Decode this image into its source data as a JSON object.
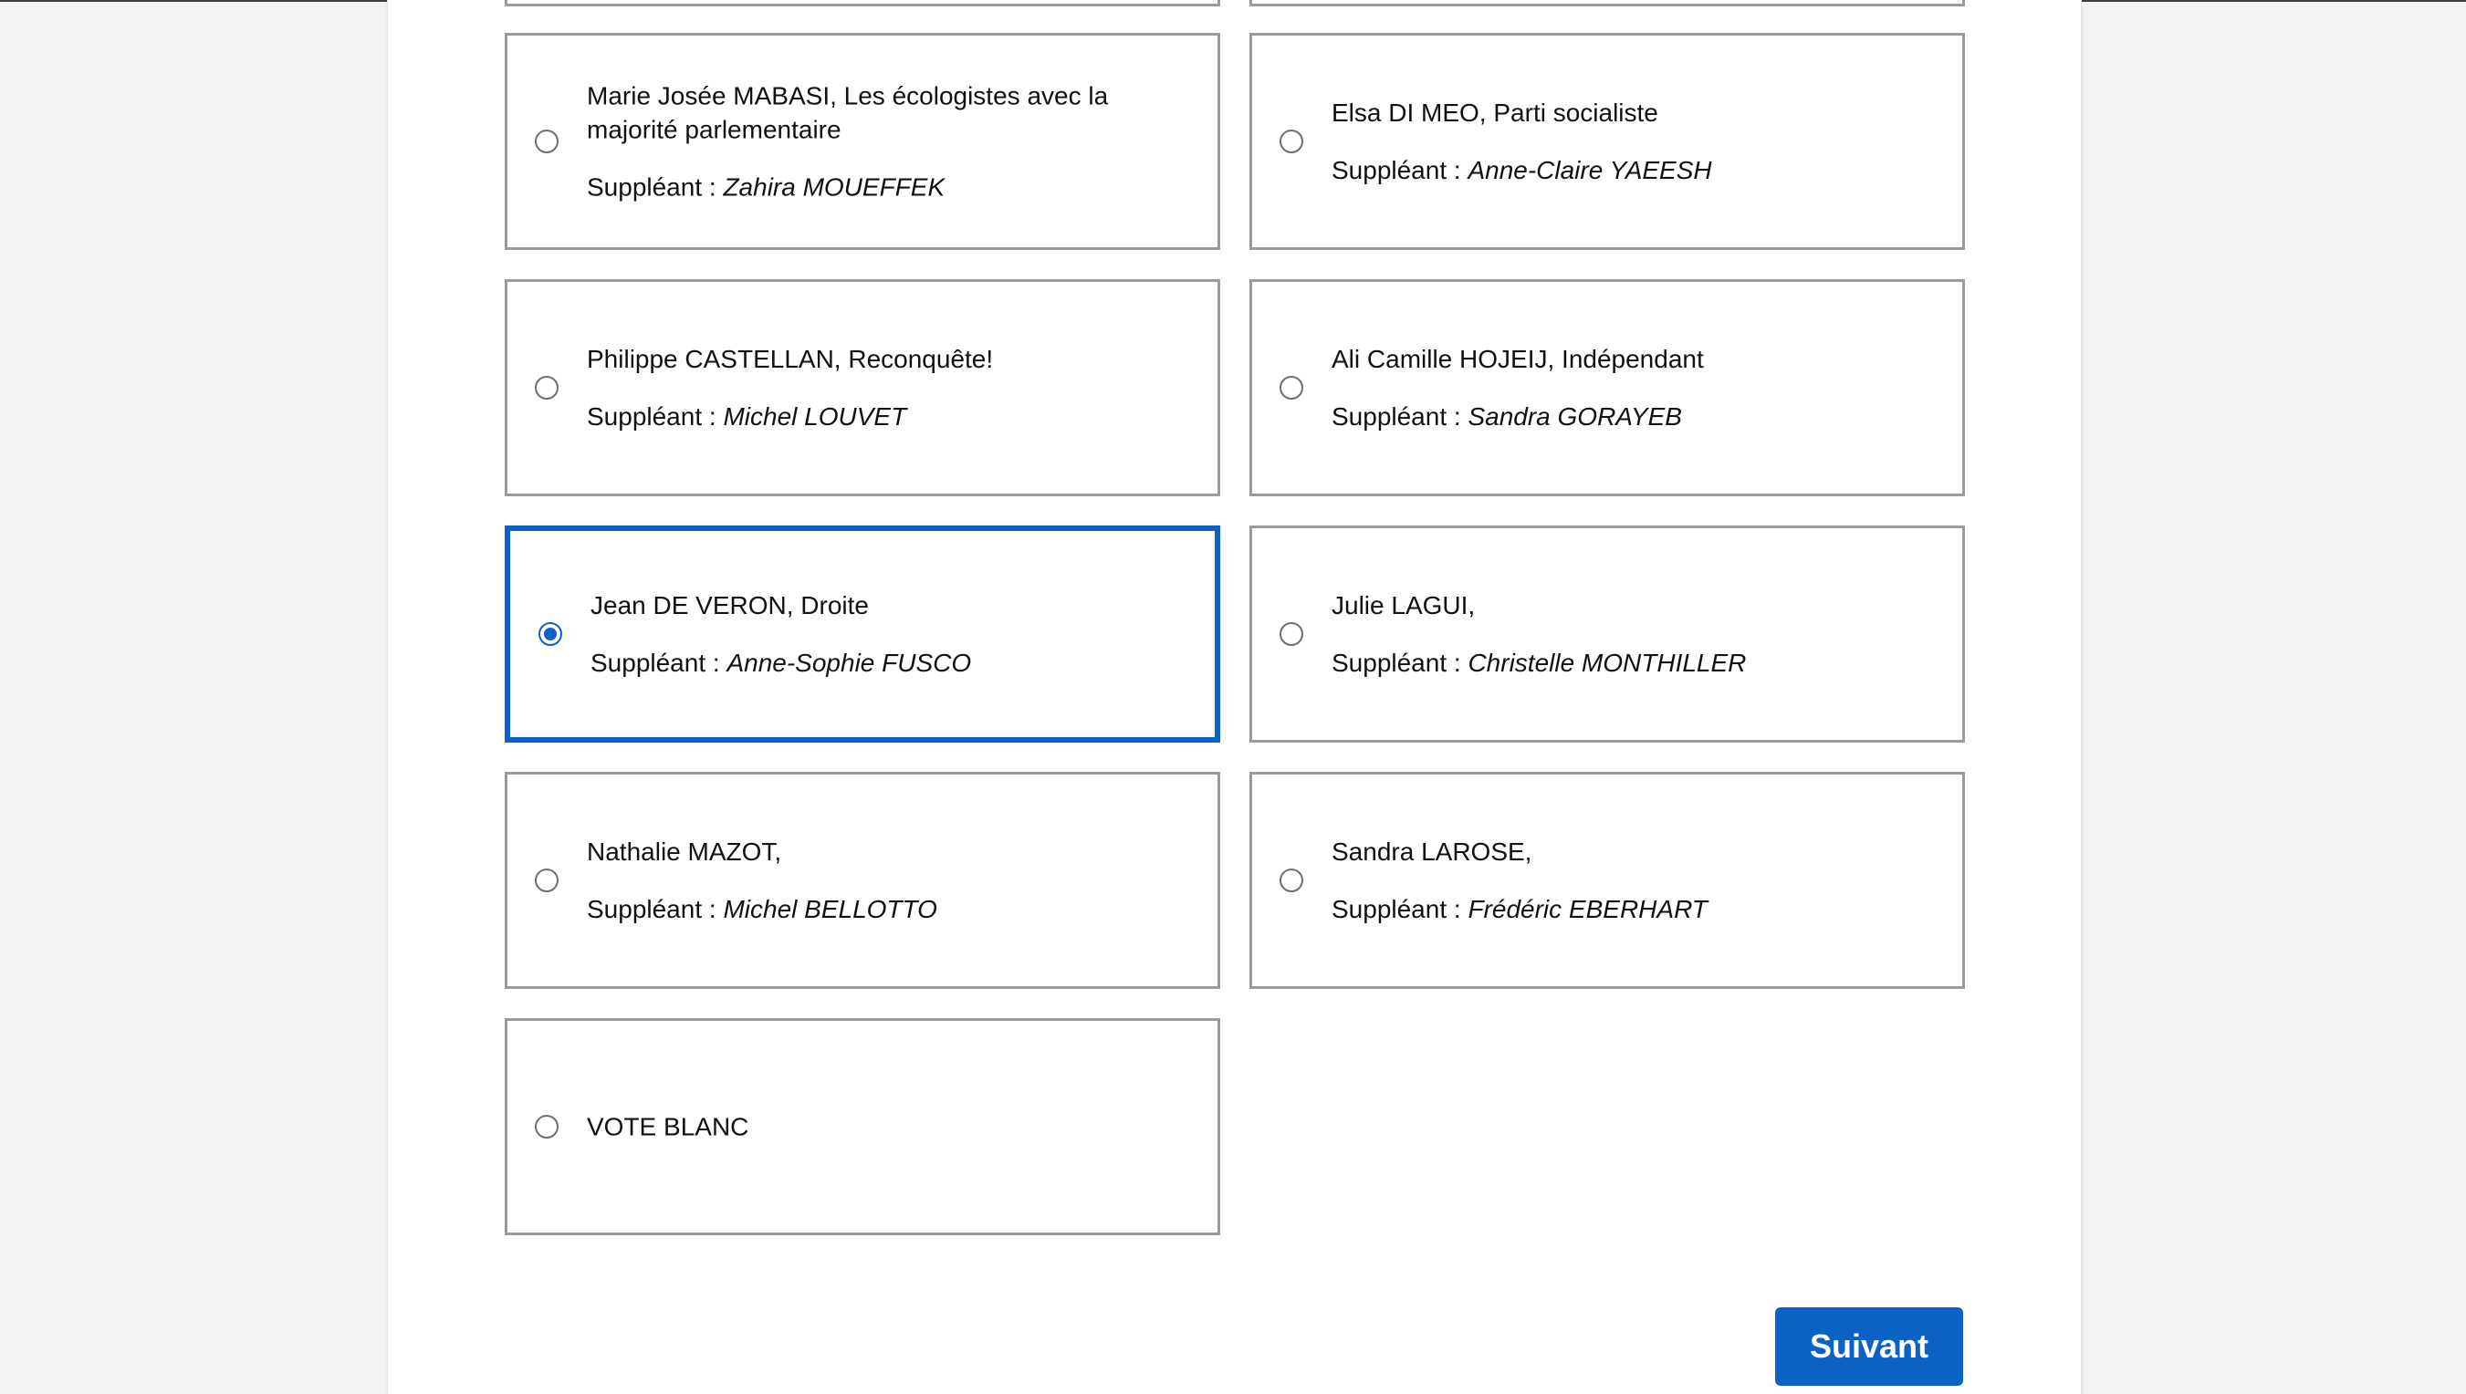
{
  "ballot": {
    "options": [
      {
        "candidate": "Marie Josée MABASI, Les écologistes avec la majorité parlementaire",
        "substitute_label": "Suppléant : ",
        "substitute": "Zahira MOUEFFEK",
        "selected": false
      },
      {
        "candidate": "Elsa DI MEO, Parti socialiste",
        "substitute_label": "Suppléant : ",
        "substitute": "Anne-Claire YAEESH",
        "selected": false
      },
      {
        "candidate": "Philippe CASTELLAN, Reconquête!",
        "substitute_label": "Suppléant : ",
        "substitute": "Michel LOUVET",
        "selected": false
      },
      {
        "candidate": "Ali Camille HOJEIJ, Indépendant",
        "substitute_label": "Suppléant : ",
        "substitute": "Sandra GORAYEB",
        "selected": false
      },
      {
        "candidate": "Jean DE VERON, Droite",
        "substitute_label": "Suppléant : ",
        "substitute": "Anne-Sophie FUSCO",
        "selected": true
      },
      {
        "candidate": "Julie LAGUI,",
        "substitute_label": "Suppléant : ",
        "substitute": "Christelle MONTHILLER",
        "selected": false
      },
      {
        "candidate": "Nathalie MAZOT,",
        "substitute_label": "Suppléant : ",
        "substitute": "Michel BELLOTTO",
        "selected": false
      },
      {
        "candidate": "Sandra LAROSE,",
        "substitute_label": "Suppléant : ",
        "substitute": "Frédéric EBERHART",
        "selected": false
      },
      {
        "candidate": "VOTE BLANC",
        "substitute_label": "",
        "substitute": "",
        "selected": false
      }
    ]
  },
  "actions": {
    "next_label": "Suivant"
  },
  "colors": {
    "accent": "#0b62c4",
    "card_border": "#9b9b9b"
  }
}
